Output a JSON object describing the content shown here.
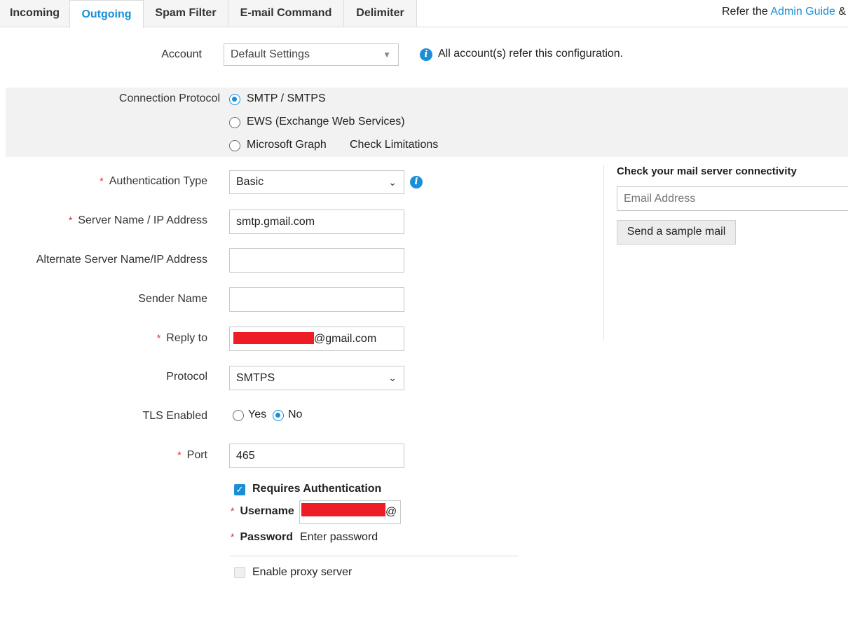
{
  "tabs": [
    {
      "label": "Incoming"
    },
    {
      "label": "Outgoing"
    },
    {
      "label": "Spam Filter"
    },
    {
      "label": "E-mail Command"
    },
    {
      "label": "Delimiter"
    }
  ],
  "header": {
    "refer_prefix": "Refer the",
    "admin_guide_link": "Admin Guide",
    "refer_suffix": "&"
  },
  "account": {
    "label": "Account",
    "selected": "Default Settings",
    "info_text": "All account(s) refer this configuration."
  },
  "connection_protocol": {
    "label": "Connection Protocol",
    "options": [
      {
        "label": "SMTP / SMTPS",
        "selected": true
      },
      {
        "label": "EWS (Exchange Web Services)",
        "selected": false
      },
      {
        "label": "Microsoft Graph",
        "selected": false
      }
    ],
    "check_limitations_link": "Check Limitations"
  },
  "form": {
    "required_mark": "*",
    "auth_type": {
      "label": "Authentication Type",
      "value": "Basic"
    },
    "server_name": {
      "label": "Server Name / IP Address",
      "value": "smtp.gmail.com"
    },
    "alt_server": {
      "label": "Alternate Server Name/IP Address",
      "value": ""
    },
    "sender_name": {
      "label": "Sender Name",
      "value": ""
    },
    "reply_to": {
      "label": "Reply to",
      "value_suffix": "@gmail.com"
    },
    "protocol": {
      "label": "Protocol",
      "value": "SMTPS"
    },
    "tls": {
      "label": "TLS Enabled",
      "yes": "Yes",
      "no": "No",
      "selected": "No"
    },
    "port": {
      "label": "Port",
      "value": "465"
    },
    "requires_auth": {
      "label": "Requires Authentication",
      "checked": true
    },
    "username": {
      "label": "Username",
      "value_suffix": "@"
    },
    "password": {
      "label": "Password",
      "link": "Enter password"
    },
    "proxy": {
      "label": "Enable proxy server",
      "checked": false
    }
  },
  "connectivity": {
    "title": "Check your mail server connectivity",
    "email_placeholder": "Email Address",
    "send_button": "Send a sample mail"
  },
  "colors": {
    "accent": "#1a8fd8",
    "required": "#e02424",
    "redaction": "#ee1c25"
  }
}
